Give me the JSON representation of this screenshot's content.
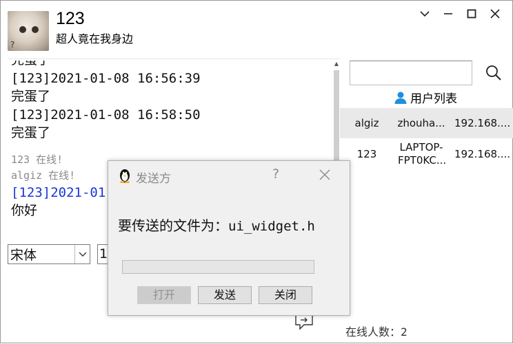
{
  "header": {
    "title": "123",
    "subtitle": "超人竟在我身边",
    "avatar_badge": "?"
  },
  "chat": {
    "messages_top": [
      {
        "text": "完蛋了",
        "style": "normal"
      },
      {
        "text": "[123]2021-01-08 16:56:39",
        "style": "normal"
      },
      {
        "text": "完蛋了",
        "style": "normal"
      },
      {
        "text": "[123]2021-01-08 16:58:50",
        "style": "normal"
      },
      {
        "text": "完蛋了",
        "style": "normal"
      }
    ],
    "status_lines": [
      "123 在线!",
      "algiz 在线!"
    ],
    "current_header": "[123]2021-01",
    "current_text": "你好"
  },
  "toolbar": {
    "font_value": "宋体",
    "size_value": "1"
  },
  "user_panel": {
    "list_title": "用户列表",
    "users": [
      {
        "name": "algiz",
        "host": "zhouha...",
        "ip": "192.168...."
      },
      {
        "name": "123",
        "host": "LAPTOP-FPT0KC...",
        "ip": "192.168...."
      }
    ],
    "online_label": "在线人数：",
    "online_count": "2"
  },
  "dialog": {
    "title": "发送方",
    "help": "?",
    "message_prefix": "要传送的文件为：",
    "filename": "ui_widget.h",
    "progress": 0,
    "open_label": "打开",
    "send_label": "发送",
    "close_label": "关闭"
  },
  "colors": {
    "user_icon": "#1e8fe0",
    "link_blue": "#1a35d6",
    "progress_fill": "#06b025"
  }
}
